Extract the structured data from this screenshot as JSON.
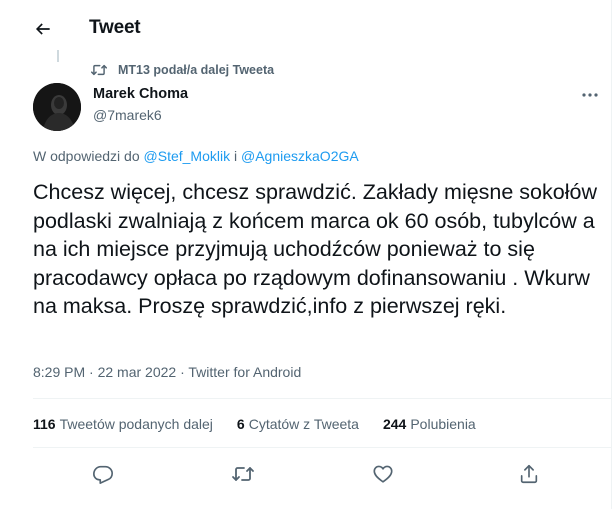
{
  "header": {
    "title": "Tweet",
    "back_icon": "arrow-left-icon"
  },
  "retweet_context": {
    "text": "MT13 podał/a dalej Tweeta",
    "icon": "retweet-icon"
  },
  "author": {
    "name": "Marek Choma",
    "handle": "@7marek6"
  },
  "reply_to": {
    "prefix": "W odpowiedzi do",
    "mention_1": "@Stef_Moklik",
    "conjunction": "i",
    "mention_2": "@AgnieszkaO2GA"
  },
  "tweet": {
    "text": "Chcesz więcej,  chcesz sprawdzić. Zakłady mięsne sokołów podlaski zwalniają z końcem marca ok 60 osób,  tubylców a na ich miejsce przyjmują uchodźców ponieważ to się pracodawcy opłaca po rządowym dofinansowaniu . Wkurw na maksa. Proszę sprawdzić,info z pierwszej ręki."
  },
  "meta": {
    "time": "8:29 PM",
    "separator": "·",
    "date": "22 mar 2022",
    "source": "Twitter for Android"
  },
  "stats": {
    "retweets_count": "116",
    "retweets_label": "Tweetów podanych dalej",
    "quotes_count": "6",
    "quotes_label": "Cytatów z Tweeta",
    "likes_count": "244",
    "likes_label": "Polubienia"
  },
  "actions": [
    "reply-icon",
    "retweet-icon",
    "like-icon",
    "share-icon"
  ],
  "colors": {
    "text": "#0f1419",
    "secondary": "#536471",
    "link": "#1d9bf0",
    "divider": "#eff3f4"
  }
}
